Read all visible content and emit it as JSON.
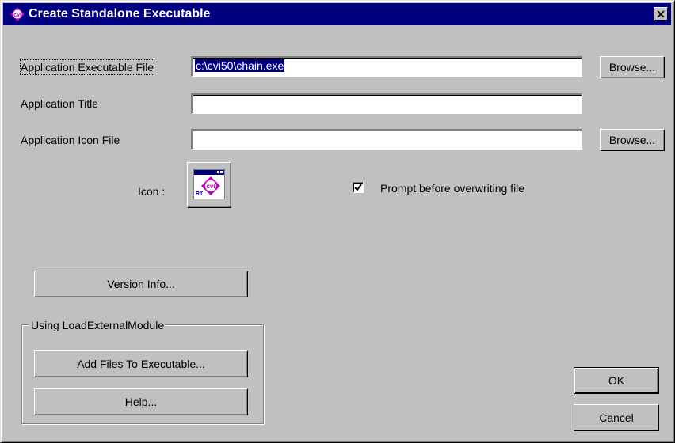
{
  "window": {
    "title": "Create Standalone Executable",
    "close_glyph": "✕"
  },
  "fields": {
    "exe_file": {
      "label": "Application Executable File",
      "value": "c:\\cvi50\\chain.exe"
    },
    "app_title": {
      "label": "Application Title",
      "value": ""
    },
    "icon_file": {
      "label": "Application Icon File",
      "value": ""
    }
  },
  "buttons": {
    "browse_exe": "Browse...",
    "browse_icon": "Browse...",
    "version_info": "Version Info...",
    "add_files": "Add Files To Executable...",
    "help": "Help...",
    "ok": "OK",
    "cancel": "Cancel"
  },
  "icon_section": {
    "label": "Icon :",
    "icon_name": "cvi-application-icon"
  },
  "prompt_checkbox": {
    "label": "Prompt before overwriting file",
    "checked": true
  },
  "group": {
    "legend": "Using LoadExternalModule"
  },
  "colors": {
    "titlebar": "#000080",
    "face": "#c0c0c0",
    "selection": "#000080"
  }
}
